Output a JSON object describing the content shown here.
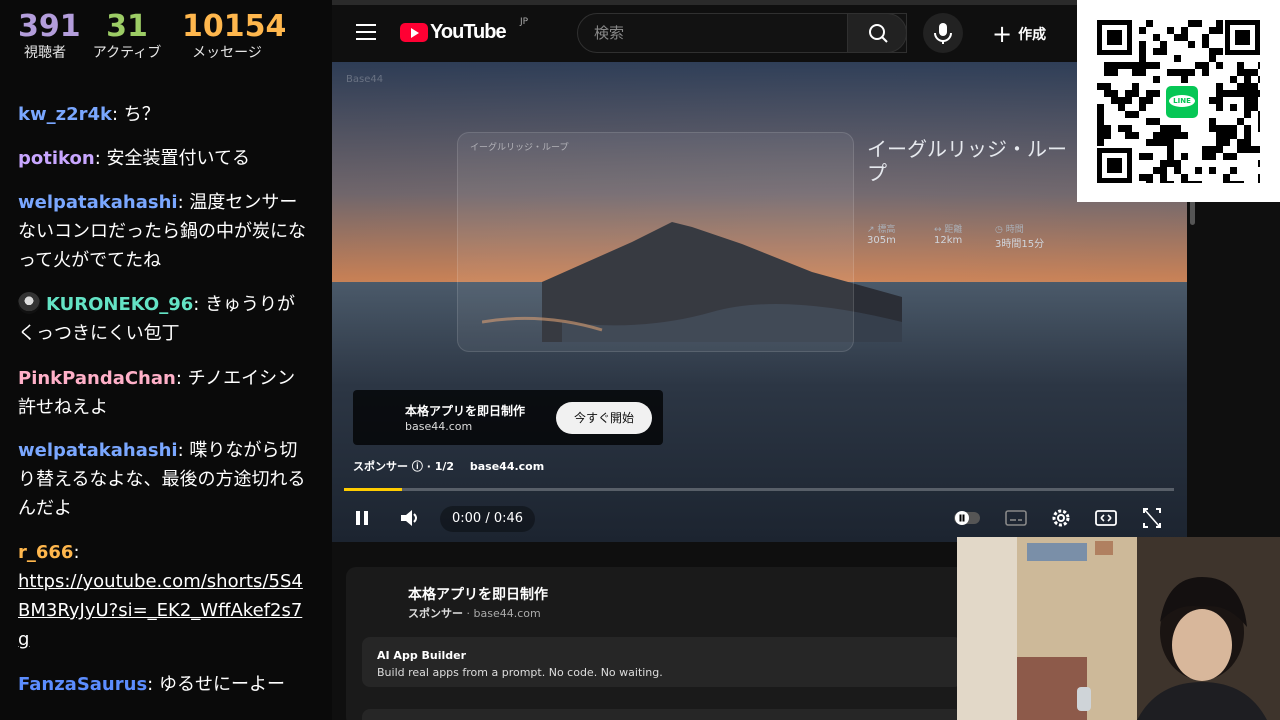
{
  "stats": [
    {
      "value": "391",
      "label": "視聴者",
      "color": "#b39ddb"
    },
    {
      "value": "31",
      "label": "アクティブ",
      "color": "#9ccc65"
    },
    {
      "value": "10154",
      "label": "メッセージ",
      "color": "#ffb74d"
    }
  ],
  "chat": [
    {
      "user": "kw_z2r4k",
      "color": "#7aa7ff",
      "text": "ち？"
    },
    {
      "user": "potikon",
      "color": "#c8a6ff",
      "text": "安全装置付いてる"
    },
    {
      "user": "welpatakahashi",
      "color": "#7aa7ff",
      "text": "温度センサーないコンロだったら鍋の中が炭になって火がでてたね"
    },
    {
      "user": "KURONEKO_96",
      "color": "#64e3c5",
      "text": "きゅうりがくっつきにくい包丁"
    },
    {
      "user": "PinkPandaChan",
      "color": "#ffb0c8",
      "text": "チノエイシン許せねえよ"
    },
    {
      "user": "welpatakahashi",
      "color": "#7aa7ff",
      "text": "喋りながら切り替えるなよな、最後の方途切れるんだよ"
    },
    {
      "user": "r_666",
      "color": "#ffb74d",
      "text": "",
      "link": "https://youtube.com/shorts/5S4BM3RyJyU?si=_EK2_WffAkef2s7g"
    },
    {
      "user": "FanzaSaurus",
      "color": "#5c8dff",
      "text": "ゆるせにーよー"
    }
  ],
  "youtube": {
    "logo_text": "YouTube",
    "region": "JP",
    "search_placeholder": "検索",
    "create_label": "作成",
    "video": {
      "watermark": "Base44",
      "card_small": "イーグルリッジ・ループ",
      "trail_title": "イーグルリッジ・ループ",
      "stats": [
        {
          "key": "↗ 標高",
          "value": "305m"
        },
        {
          "key": "↔ 距離",
          "value": "12km"
        },
        {
          "key": "◷ 時間",
          "value": "3時間15分"
        }
      ],
      "ad_title": "本格アプリを即日制作",
      "ad_domain": "base44.com",
      "ad_cta": "今すぐ開始",
      "sponsor_label": "スポンサー",
      "sponsor_count": "· 1/2",
      "sponsor_domain": "base44.com",
      "time": "0:00 / 0:46",
      "progress": 0.07
    },
    "below": {
      "title": "本格アプリを即日制作",
      "sponsor": "スポンサー",
      "domain": "base44.com",
      "inner_title": "AI App Builder",
      "inner_desc": "Build real apps from a prompt. No code. No waiting."
    }
  },
  "qr_badge": "LINE"
}
